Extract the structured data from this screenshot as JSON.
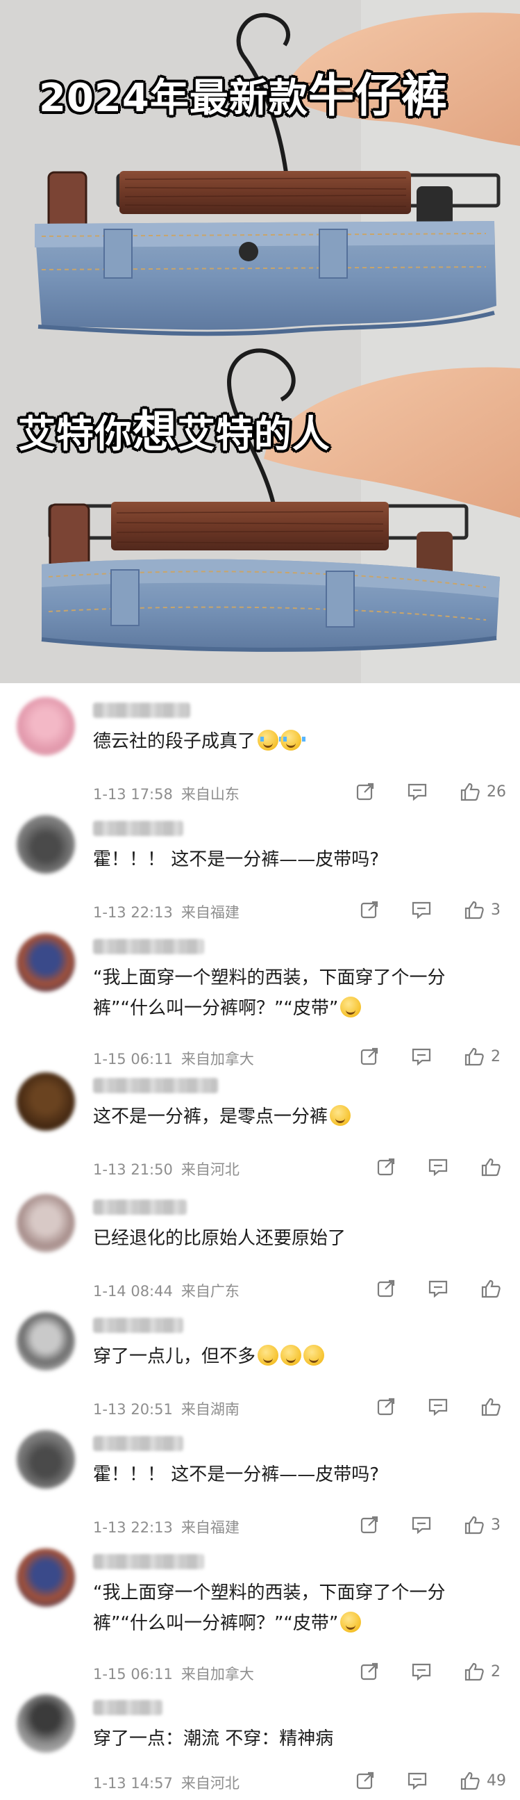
{
  "hero": {
    "caption_top": {
      "a": "2024年最新款",
      "b": "牛仔裤"
    },
    "caption_bottom": {
      "a": "艾特你",
      "b": "想",
      "c": "艾特的人"
    }
  },
  "comments": [
    {
      "text": "德云社的段子成真了",
      "emoji": "😭😭",
      "date": "1-13 17:58",
      "location": "来自山东",
      "likes": "26"
    },
    {
      "text": "霍！！！ 这不是一分裤——皮带吗?",
      "emoji": "",
      "date": "1-13 22:13",
      "location": "来自福建",
      "likes": "3"
    },
    {
      "text_line1": "“我上面穿一个塑料的西装，下面穿了个一分",
      "text_line2": "裤”“什么叫一分裤啊？”“皮带”",
      "emoji": "😂",
      "date": "1-15 06:11",
      "location": "来自加拿大",
      "likes": "2"
    },
    {
      "text": "这不是一分裤，是零点一分裤",
      "emoji": "🙂",
      "date": "1-13 21:50",
      "location": "来自河北",
      "likes": ""
    },
    {
      "text": "已经退化的比原始人还要原始了",
      "emoji": "",
      "date": "1-14 08:44",
      "location": "来自广东",
      "likes": ""
    },
    {
      "text": "穿了一点儿，但不多",
      "emoji": "😂😂😂",
      "date": "1-13 20:51",
      "location": "来自湖南",
      "likes": ""
    },
    {
      "text": "霍！！！ 这不是一分裤——皮带吗?",
      "emoji": "",
      "date": "1-13 22:13",
      "location": "来自福建",
      "likes": "3"
    },
    {
      "text_line1": "“我上面穿一个塑料的西装，下面穿了个一分",
      "text_line2": "裤”“什么叫一分裤啊？”“皮带”",
      "emoji": "😂",
      "date": "1-15 06:11",
      "location": "来自加拿大",
      "likes": "2"
    },
    {
      "text": "穿了一点：潮流 不穿：精神病",
      "emoji": "",
      "date": "1-13 14:57",
      "location": "来自河北",
      "likes": "49"
    }
  ],
  "colors": {
    "text": "#1c1c1c",
    "meta": "#8e8e8e",
    "icon": "#7d7d7d",
    "divider": "#ececec"
  },
  "icons": [
    "share-icon",
    "comment-icon",
    "like-icon"
  ]
}
